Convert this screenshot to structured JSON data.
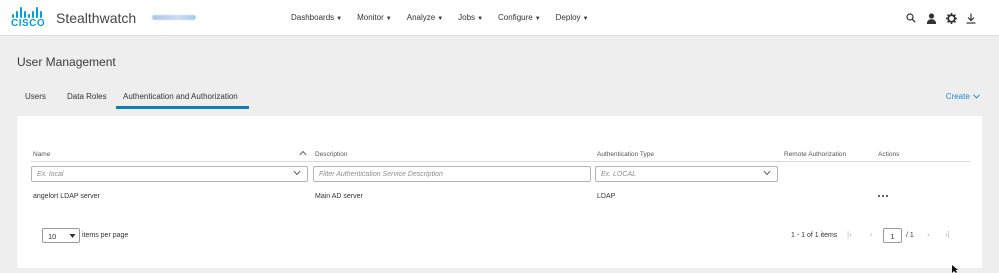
{
  "header": {
    "logo_text": "CISCO",
    "app_title": "Stealthwatch",
    "nav": [
      {
        "label": "Dashboards"
      },
      {
        "label": "Monitor"
      },
      {
        "label": "Analyze"
      },
      {
        "label": "Jobs"
      },
      {
        "label": "Configure"
      },
      {
        "label": "Deploy"
      }
    ],
    "icons": [
      "search-icon",
      "user-icon",
      "gear-icon",
      "download-icon"
    ]
  },
  "page": {
    "title": "User Management",
    "tabs": [
      {
        "label": "Users"
      },
      {
        "label": "Data Roles"
      },
      {
        "label": "Authentication and Authorization",
        "active": true
      }
    ],
    "create_label": "Create"
  },
  "table": {
    "columns": [
      "Name",
      "Description",
      "Authentication Type",
      "Remote Authorization",
      "Actions"
    ],
    "filters": {
      "name_placeholder": "Ex. local",
      "description_placeholder": "Filter Authentication Service Description",
      "type_placeholder": "Ex. LOCAL"
    },
    "rows": [
      {
        "name": "angelort LDAP server",
        "description": "Main AD server",
        "type": "LDAP",
        "remote_authorization": ""
      }
    ]
  },
  "pagination": {
    "per_page": "10",
    "per_page_label": "items per page",
    "range_text": "1 - 1 of 1 items",
    "current_page": "1",
    "total_text": "/ 1"
  },
  "colors": {
    "accent": "#0d7db4",
    "link": "#1d8bd1",
    "cisco_blue": "#049fd9",
    "background": "#eeeeef"
  }
}
